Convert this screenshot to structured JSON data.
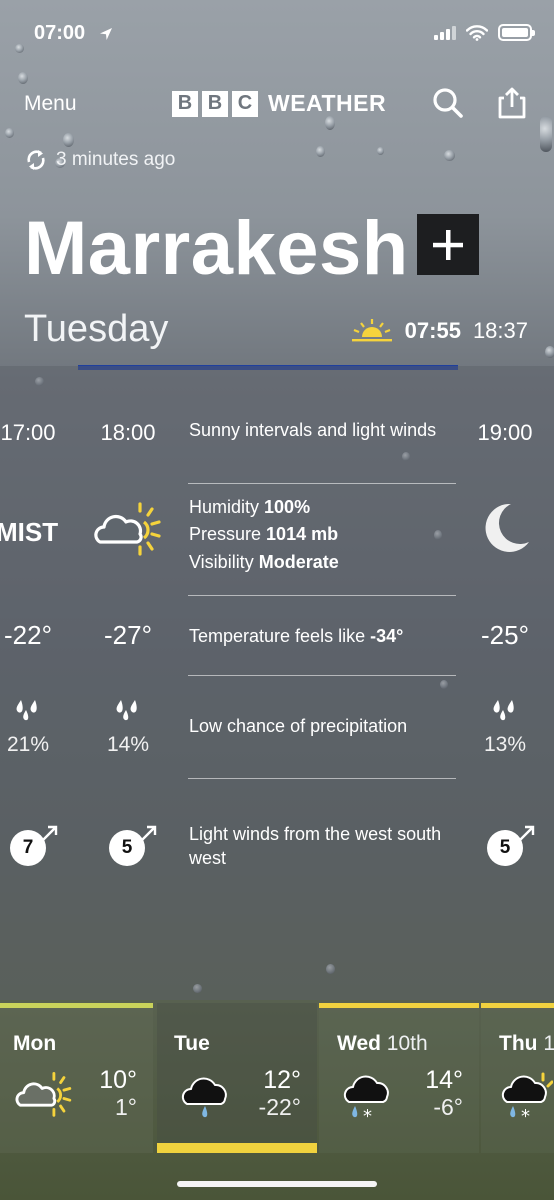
{
  "status_bar": {
    "time": "07:00"
  },
  "header": {
    "menu_label": "Menu",
    "logo_letters": [
      "B",
      "B",
      "C"
    ],
    "logo_word": "WEATHER"
  },
  "updated": "3 minutes ago",
  "location": {
    "city": "Marrakesh",
    "day": "Tuesday",
    "sunrise": "07:55",
    "sunset": "18:37"
  },
  "hourly": [
    {
      "time": "17:00",
      "condition": "MIST",
      "temp": "-22°",
      "precip": "21%",
      "wind": "7"
    },
    {
      "time": "18:00",
      "condition": "cloud-sun-icon",
      "temp": "-27°",
      "precip": "14%",
      "wind": "5"
    },
    {
      "time": "19:00",
      "condition": "moon-icon",
      "temp": "-25°",
      "precip": "13%",
      "wind": "5"
    }
  ],
  "detail": {
    "summary": "Sunny intervals and light winds",
    "humidity_label": "Humidity",
    "humidity_value": "100%",
    "pressure_label": "Pressure",
    "pressure_value": "1014 mb",
    "visibility_label": "Visibility",
    "visibility_value": "Moderate",
    "feels_label": "Temperature feels like",
    "feels_value": "-34°",
    "precip_text": "Low chance of precipitation",
    "wind_text": "Light winds from the west south west"
  },
  "days": [
    {
      "name": "Mon",
      "date": "",
      "high": "10°",
      "low": "1°",
      "icon": "cloud-sun-icon"
    },
    {
      "name": "Tue",
      "date": "",
      "high": "12°",
      "low": "-22°",
      "icon": "rain-cloud-icon"
    },
    {
      "name": "Wed",
      "date": "10th",
      "high": "14°",
      "low": "-6°",
      "icon": "sleet-cloud-icon"
    },
    {
      "name": "Thu",
      "date": "1",
      "high": "",
      "low": "",
      "icon": "sleet-cloud-icon"
    }
  ],
  "colors": {
    "accent_blue": "#1f3f9d",
    "sun_yellow": "#f5d33c",
    "selected_day_bar": "#f0d23e"
  }
}
